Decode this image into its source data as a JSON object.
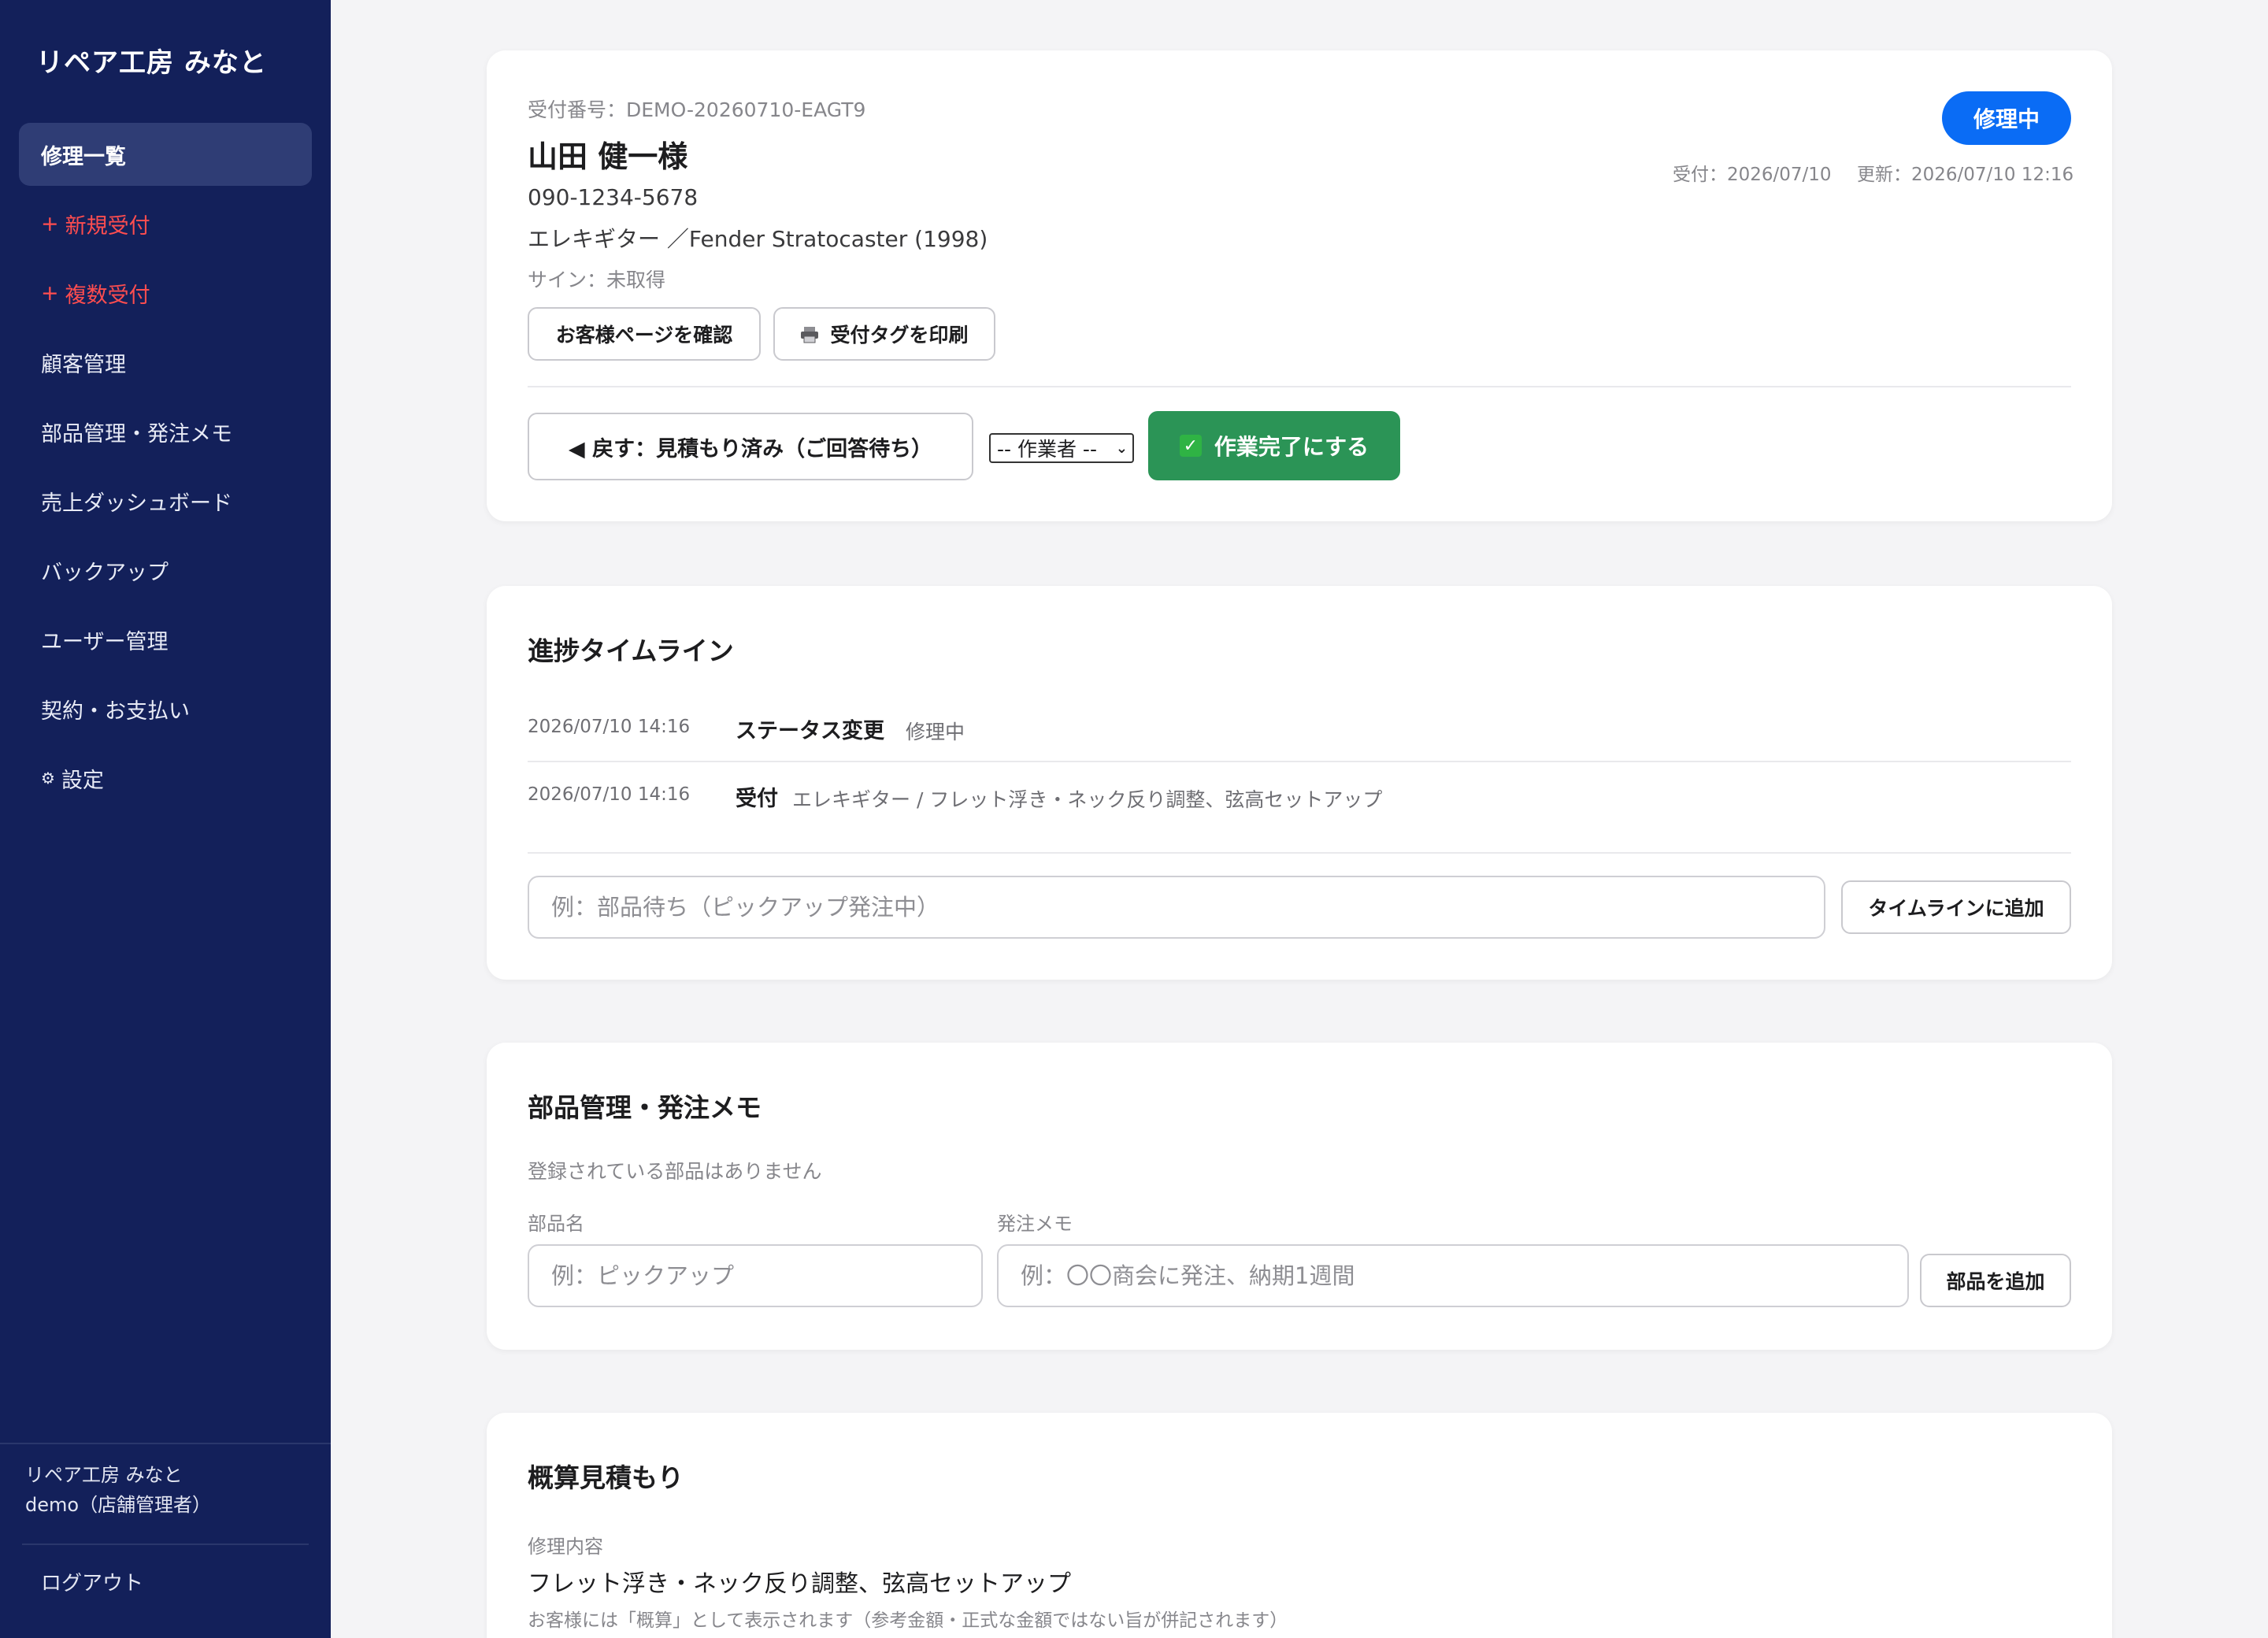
{
  "sidebar": {
    "brand": "リペア工房 みなと",
    "items": [
      {
        "label": "修理一覧",
        "glyph": ""
      },
      {
        "label": "新規受付",
        "glyph": "+"
      },
      {
        "label": "複数受付",
        "glyph": "+"
      },
      {
        "label": "顧客管理",
        "glyph": ""
      },
      {
        "label": "部品管理・発注メモ",
        "glyph": ""
      },
      {
        "label": "売上ダッシュボード",
        "glyph": ""
      },
      {
        "label": "バックアップ",
        "glyph": ""
      },
      {
        "label": "ユーザー管理",
        "glyph": ""
      },
      {
        "label": "契約・お支払い",
        "glyph": ""
      },
      {
        "label": "設定",
        "glyph": "⚙"
      }
    ],
    "shop_name": "リペア工房 みなと",
    "user": "demo（店舗管理者）",
    "logout": "ログアウト"
  },
  "ticket": {
    "number": "受付番号：DEMO-20260710-EAGT9",
    "customer": "山田 健一様",
    "phone": "090-1234-5678",
    "instrument": "エレキギター ／Fender Stratocaster (1998)",
    "signature": "サイン：未取得",
    "status": "修理中",
    "received": "受付：2026/07/10",
    "updated": "更新：2026/07/10 12:16",
    "customer_page_button": "お客様ページを確認",
    "print_tag_button": "受付タグを印刷",
    "print_icon": "printer-icon",
    "back_button": "◀ 戻す：見積もり済み（ご回答待ち）",
    "worker_select": "-- 作業者 --",
    "complete_button": "作業完了にする"
  },
  "timeline": {
    "title": "進捗タイムライン",
    "entries": [
      {
        "time": "2026/07/10 14:16",
        "kind": "ステータス変更",
        "text": "修理中"
      },
      {
        "time": "2026/07/10 14:16",
        "kind": "受付",
        "text": "エレキギター / フレット浮き・ネック反り調整、弦高セットアップ"
      }
    ],
    "placeholder": "例：部品待ち（ピックアップ発注中）",
    "add_button": "タイムラインに追加"
  },
  "parts": {
    "title": "部品管理・発注メモ",
    "empty": "登録されている部品はありません",
    "name_label": "部品名",
    "name_placeholder": "例：ピックアップ",
    "memo_label": "発注メモ",
    "memo_placeholder": "例：〇〇商会に発注、納期1週間",
    "add_button": "部品を追加"
  },
  "estimate": {
    "title": "概算見積もり",
    "content_label": "修理内容",
    "content": "フレット浮き・ネック反り調整、弦高セットアップ",
    "note": "お客様には「概算」として表示されます（参考金額・正式な金額ではない旨が併記されます）"
  },
  "colors": {
    "sidebar": "#13205a",
    "accent": "#0a6cf5",
    "success": "#2b9456",
    "danger": "#ff4d4f"
  }
}
